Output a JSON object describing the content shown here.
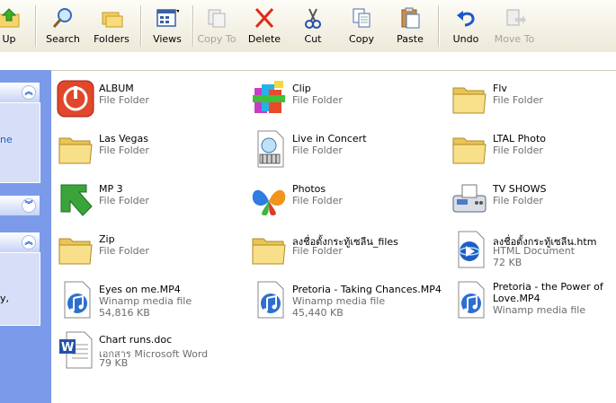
{
  "toolbar": {
    "buttons": [
      {
        "id": "up",
        "label": "Up",
        "icon": "folder-up-icon",
        "enabled": true
      },
      {
        "id": "search",
        "label": "Search",
        "icon": "search-icon",
        "enabled": true
      },
      {
        "id": "folders",
        "label": "Folders",
        "icon": "folders-icon",
        "enabled": true
      },
      {
        "id": "views",
        "label": "Views",
        "icon": "views-icon",
        "enabled": true
      },
      {
        "id": "copyto",
        "label": "Copy To",
        "icon": "copy-to-icon",
        "enabled": false
      },
      {
        "id": "delete",
        "label": "Delete",
        "icon": "delete-icon",
        "enabled": true
      },
      {
        "id": "cut",
        "label": "Cut",
        "icon": "scissors-icon",
        "enabled": true
      },
      {
        "id": "copy",
        "label": "Copy",
        "icon": "copy-icon",
        "enabled": true
      },
      {
        "id": "paste",
        "label": "Paste",
        "icon": "paste-icon",
        "enabled": true
      },
      {
        "id": "undo",
        "label": "Undo",
        "icon": "undo-icon",
        "enabled": true
      },
      {
        "id": "moveto",
        "label": "Move To",
        "icon": "move-to-icon",
        "enabled": false
      }
    ]
  },
  "taskpane": {
    "fragment1": "ne",
    "fragment2": "y,"
  },
  "files": [
    {
      "name": "ALBUM",
      "type": "File Folder",
      "size": "",
      "icon": "power-red-icon"
    },
    {
      "name": "Clip",
      "type": "File Folder",
      "size": "",
      "icon": "winrar-icon"
    },
    {
      "name": "Flv",
      "type": "File Folder",
      "size": "",
      "icon": "folder-icon"
    },
    {
      "name": "Las Vegas",
      "type": "File Folder",
      "size": "",
      "icon": "folder-icon"
    },
    {
      "name": "Live in Concert",
      "type": "File Folder",
      "size": "",
      "icon": "media-folder-icon"
    },
    {
      "name": "LTAL Photo",
      "type": "File Folder",
      "size": "",
      "icon": "folder-icon"
    },
    {
      "name": "MP 3",
      "type": "File Folder",
      "size": "",
      "icon": "green-arrow-icon"
    },
    {
      "name": "Photos",
      "type": "File Folder",
      "size": "",
      "icon": "butterfly-icon"
    },
    {
      "name": "TV SHOWS",
      "type": "File Folder",
      "size": "",
      "icon": "fax-icon"
    },
    {
      "name": "Zip",
      "type": "File Folder",
      "size": "",
      "icon": "folder-icon"
    },
    {
      "name": "ลงชื่อตั้งกระทู้เซลีน_files",
      "type": "File Folder",
      "size": "",
      "icon": "folder-icon"
    },
    {
      "name": "ลงชื่อตั้งกระทู้เซลีน.htm",
      "type": "HTML Document",
      "size": "72 KB",
      "icon": "html-document-icon"
    },
    {
      "name": "Eyes on me.MP4",
      "type": "Winamp media file",
      "size": "54,816 KB",
      "icon": "winamp-media-icon"
    },
    {
      "name": "Pretoria - Taking Chances.MP4",
      "type": "Winamp media file",
      "size": "45,440 KB",
      "icon": "winamp-media-icon"
    },
    {
      "name": "Pretoria - the Power of Love.MP4",
      "type": "Winamp media file",
      "size": "",
      "icon": "winamp-media-icon"
    },
    {
      "name": "Chart runs.doc",
      "type": "เอกสาร Microsoft Word",
      "size": "79 KB",
      "icon": "word-document-icon"
    }
  ]
}
